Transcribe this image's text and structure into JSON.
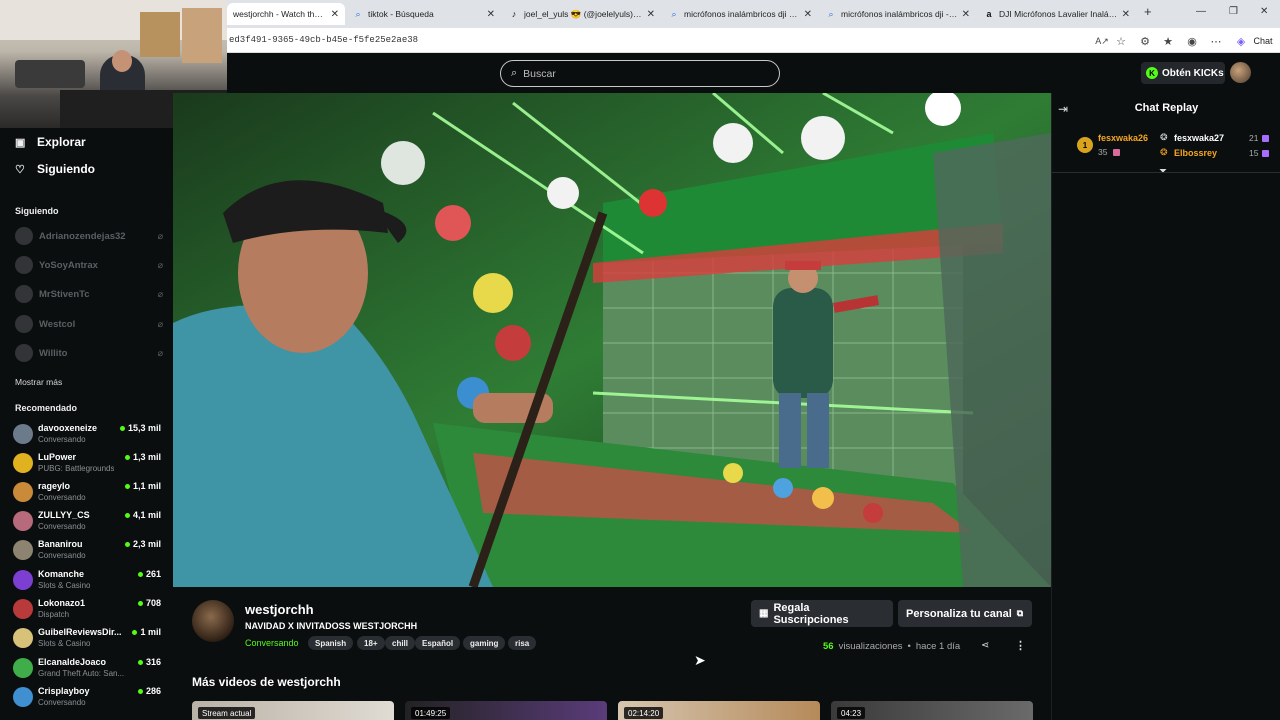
{
  "browser": {
    "tabs": [
      {
        "title": "westjorchh - Watch the VOD",
        "icon": "kick-icon",
        "active": true
      },
      {
        "title": "tiktok - Búsqueda",
        "icon": "search-icon"
      },
      {
        "title": "joel_el_yuls 😎 (@joelelyuls) | TikT",
        "icon": "tiktok-icon"
      },
      {
        "title": "micrófonos inalámbricos dji - Búsq",
        "icon": "search-icon"
      },
      {
        "title": "micrófonos inalámbricos dji - Búsq",
        "icon": "search-icon"
      },
      {
        "title": "DJI Micrófonos Lavalier Inalámbric",
        "icon": "amazon-icon"
      }
    ],
    "url": "ed3f491-9365-49cb-b45e-f5fe25e2ae38"
  },
  "header": {
    "search_placeholder": "Buscar",
    "kicks_label": "Obtén KICKs"
  },
  "sidebar": {
    "nav": [
      {
        "label": "Explorar",
        "icon": "compass-icon"
      },
      {
        "label": "Siguiendo",
        "icon": "heart-icon"
      }
    ],
    "following_title": "Siguiendo",
    "following": [
      {
        "name": "Adrianozendejas32"
      },
      {
        "name": "YoSoyAntrax"
      },
      {
        "name": "MrStivenTc"
      },
      {
        "name": "Westcol"
      },
      {
        "name": "Willito"
      }
    ],
    "show_more": "Mostrar más",
    "recommended_title": "Recomendado",
    "recommended": [
      {
        "name": "davooxeneize",
        "category": "Conversando",
        "viewers": "15,3 mil",
        "color": "#6b7b8c"
      },
      {
        "name": "LuPower",
        "category": "PUBG: Battlegrounds",
        "viewers": "1,3 mil",
        "color": "#e0b21f"
      },
      {
        "name": "rageylo",
        "category": "Conversando",
        "viewers": "1,1 mil",
        "color": "#c98a3a"
      },
      {
        "name": "ZULLYY_CS",
        "category": "Conversando",
        "viewers": "4,1 mil",
        "color": "#b66a7c"
      },
      {
        "name": "Bananirou",
        "category": "Conversando",
        "viewers": "2,3 mil",
        "color": "#8c8470"
      },
      {
        "name": "Komanche",
        "category": "Slots & Casino",
        "viewers": "261",
        "color": "#7c3fd1"
      },
      {
        "name": "Lokonazo1",
        "category": "Dispatch",
        "viewers": "708",
        "color": "#b83a3a"
      },
      {
        "name": "GuibelReviewsDir...",
        "category": "Slots & Casino",
        "viewers": "1 mil",
        "color": "#d8c27a"
      },
      {
        "name": "ElcanaldeJoaco",
        "category": "Grand Theft Auto: San...",
        "viewers": "316",
        "color": "#3fae4a"
      },
      {
        "name": "Crisplayboy",
        "category": "Conversando",
        "viewers": "286",
        "color": "#3f8fd1"
      }
    ]
  },
  "chat": {
    "title": "Chat Replay",
    "gifters": [
      {
        "rank": "1",
        "name": "fesxwaka26",
        "count": "35",
        "color": "#f5a623"
      },
      {
        "name": "fesxwaka27",
        "count": "21",
        "color": "#ffffff"
      },
      {
        "name": "Elbossrey",
        "count": "15",
        "color": "#f5a623"
      }
    ]
  },
  "channel": {
    "name": "westjorchh",
    "title": "NAVIDAD  X INVITADOSS WESTJORCHH",
    "category": "Conversando",
    "tags": [
      "Spanish",
      "18+",
      "chill",
      "Español",
      "gaming",
      "risa"
    ],
    "gift_subs_label": "Regala Suscripciones",
    "customize_label": "Personaliza tu canal",
    "views_num": "56",
    "views_label": "visualizaciones",
    "separator": "•",
    "time_ago": "hace 1 día"
  },
  "more_videos": {
    "title": "Más videos de westjorchh",
    "items": [
      {
        "badge": "Stream actual"
      },
      {
        "badge": "01:49:25"
      },
      {
        "badge": "02:14:20"
      },
      {
        "badge": "04:23"
      }
    ]
  },
  "colors": {
    "accent": "#53fc18",
    "background": "#0b0e0f",
    "button": "#2a2d31"
  }
}
